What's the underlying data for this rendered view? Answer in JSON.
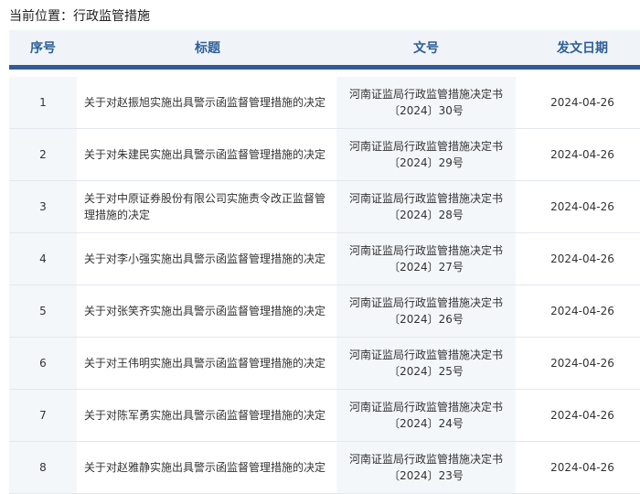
{
  "breadcrumb": "当前位置：行政监管措施",
  "table": {
    "headers": [
      "序号",
      "标题",
      "文号",
      "发文日期"
    ],
    "rows": [
      {
        "no": "1",
        "title": "关于对赵振旭实施出具警示函监督管理措施的决定",
        "doc_line1": "河南证监局行政监管措施决定书",
        "doc_line2": "〔2024〕30号",
        "date": "2024-04-26"
      },
      {
        "no": "2",
        "title": "关于对朱建民实施出具警示函监督管理措施的决定",
        "doc_line1": "河南证监局行政监管措施决定书",
        "doc_line2": "〔2024〕29号",
        "date": "2024-04-26"
      },
      {
        "no": "3",
        "title": "关于对中原证券股份有限公司实施责令改正监督管理措施的决定",
        "doc_line1": "河南证监局行政监管措施决定书",
        "doc_line2": "〔2024〕28号",
        "date": "2024-04-26"
      },
      {
        "no": "4",
        "title": "关于对李小强实施出具警示函监督管理措施的决定",
        "doc_line1": "河南证监局行政监管措施决定书",
        "doc_line2": "〔2024〕27号",
        "date": "2024-04-26"
      },
      {
        "no": "5",
        "title": "关于对张笑齐实施出具警示函监督管理措施的决定",
        "doc_line1": "河南证监局行政监管措施决定书",
        "doc_line2": "〔2024〕26号",
        "date": "2024-04-26"
      },
      {
        "no": "6",
        "title": "关于对王伟明实施出具警示函监督管理措施的决定",
        "doc_line1": "河南证监局行政监管措施决定书",
        "doc_line2": "〔2024〕25号",
        "date": "2024-04-26"
      },
      {
        "no": "7",
        "title": "关于对陈军勇实施出具警示函监督管理措施的决定",
        "doc_line1": "河南证监局行政监管措施决定书",
        "doc_line2": "〔2024〕24号",
        "date": "2024-04-26"
      },
      {
        "no": "8",
        "title": "关于对赵雅静实施出具警示函监督管理措施的决定",
        "doc_line1": "河南证监局行政监管措施决定书",
        "doc_line2": "〔2024〕23号",
        "date": "2024-04-26"
      }
    ]
  }
}
